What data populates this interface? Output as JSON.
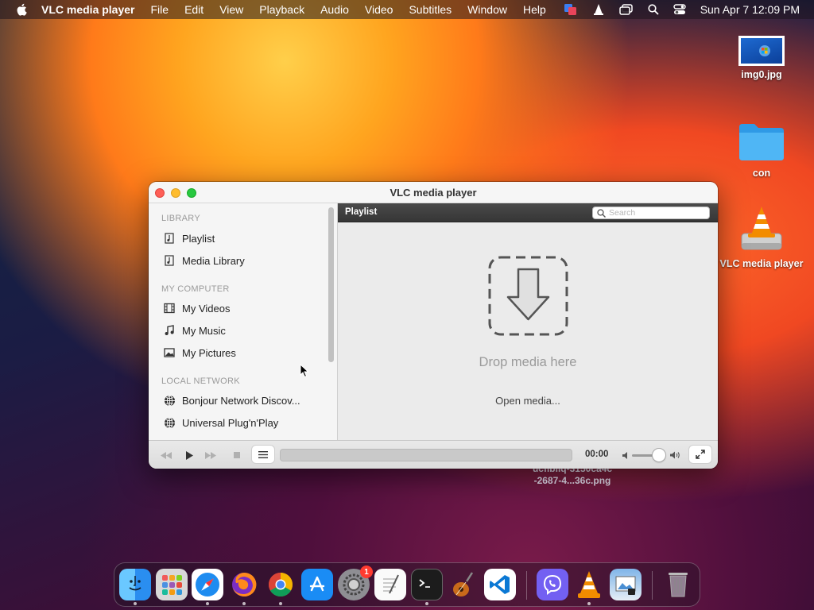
{
  "menubar": {
    "app_name": "VLC media player",
    "items": [
      "File",
      "Edit",
      "View",
      "Playback",
      "Audio",
      "Video",
      "Subtitles",
      "Window",
      "Help"
    ],
    "clock": "Sun Apr 7  12:09 PM"
  },
  "desktop": {
    "icons": [
      {
        "label": "img0.jpg",
        "icon": "image-file-icon"
      },
      {
        "label": "con",
        "icon": "folder-icon"
      },
      {
        "label": "VLC media player",
        "icon": "vlc-disk-icon"
      }
    ],
    "stray_file": {
      "line1": "ucfibliq-3150ca4c",
      "line2": "-2687-4...36c.png"
    }
  },
  "window": {
    "title": "VLC media player",
    "sidebar": {
      "sections": [
        {
          "heading": "LIBRARY",
          "items": [
            {
              "label": "Playlist",
              "icon": "playlist-icon"
            },
            {
              "label": "Media Library",
              "icon": "media-library-icon"
            }
          ]
        },
        {
          "heading": "MY COMPUTER",
          "items": [
            {
              "label": "My Videos",
              "icon": "film-icon"
            },
            {
              "label": "My Music",
              "icon": "music-note-icon"
            },
            {
              "label": "My Pictures",
              "icon": "picture-icon"
            }
          ]
        },
        {
          "heading": "LOCAL NETWORK",
          "items": [
            {
              "label": "Bonjour Network Discov...",
              "icon": "network-globe-icon"
            },
            {
              "label": "Universal Plug'n'Play",
              "icon": "network-globe-icon"
            }
          ]
        }
      ]
    },
    "playlist": {
      "title": "Playlist",
      "search_placeholder": "Search",
      "drop_text": "Drop media here",
      "open_media": "Open media..."
    },
    "controls": {
      "time": "00:00",
      "volume_fraction": 0.85
    }
  },
  "dock": {
    "apps": [
      "Finder",
      "Launchpad",
      "Safari",
      "Firefox",
      "Chrome",
      "App Store",
      "System Settings",
      "TextEdit",
      "Terminal",
      "GarageBand",
      "VS Code",
      "Viber",
      "VLC",
      "Preview",
      "Trash"
    ],
    "settings_badge": "1"
  },
  "colors": {
    "close": "#fe5f57",
    "minimize": "#febc2e",
    "maximize": "#28c840",
    "vlc_orange": "#f28c00"
  }
}
